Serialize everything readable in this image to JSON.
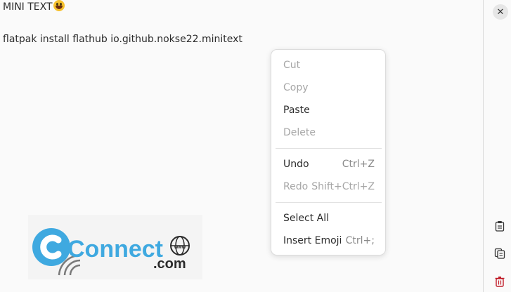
{
  "editor": {
    "line1_text": "MINI TEXT",
    "line1_emoji": "grinning-face-emoji",
    "line3_text": "flatpak install flathub io.github.nokse22.minitext"
  },
  "logo": {
    "brand_word": "Connect",
    "brand_suffix": ".com",
    "brand_www": "www",
    "brand_color": "#3fa9e0"
  },
  "context_menu": {
    "items": [
      {
        "label": "Cut",
        "accel": "",
        "enabled": false
      },
      {
        "label": "Copy",
        "accel": "",
        "enabled": false
      },
      {
        "label": "Paste",
        "accel": "",
        "enabled": true
      },
      {
        "label": "Delete",
        "accel": "",
        "enabled": false
      },
      {
        "label": "Undo",
        "accel": "Ctrl+Z",
        "enabled": true
      },
      {
        "label": "Redo",
        "accel": "Shift+Ctrl+Z",
        "enabled": false
      },
      {
        "label": "Select All",
        "accel": "",
        "enabled": true
      },
      {
        "label": "Insert Emoji",
        "accel": "Ctrl+;",
        "enabled": true
      }
    ]
  },
  "sidebar": {
    "close_glyph": "✕",
    "icons": [
      "paste-icon",
      "copy-icon",
      "trash-icon"
    ],
    "trash_color": "#c01c28"
  }
}
